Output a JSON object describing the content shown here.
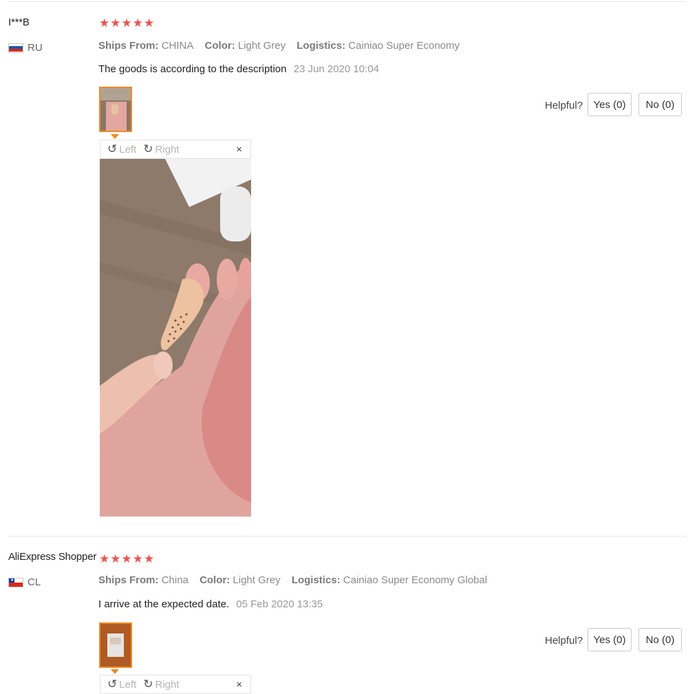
{
  "reviews": [
    {
      "user": "I***B",
      "country": "RU",
      "flag_icon": "russia-flag-icon",
      "stars": "★★★★★",
      "ships_from_label": "Ships From:",
      "ships_from": "CHINA",
      "color_label": "Color:",
      "color": "Light Grey",
      "logistics_label": "Logistics:",
      "logistics": "Cainiao Super Economy",
      "text": "The goods is according to the description",
      "date": "23 Jun 2020 10:04",
      "viewer": {
        "left": "Left",
        "right": "Right",
        "close": "×"
      },
      "helpful_label": "Helpful?",
      "yes_label": "Yes (0)",
      "no_label": "No (0)"
    },
    {
      "user": "AliExpress Shopper",
      "country": "CL",
      "flag_icon": "chile-flag-icon",
      "stars": "★★★★★",
      "ships_from_label": "Ships From:",
      "ships_from": "China",
      "color_label": "Color:",
      "color": "Light Grey",
      "logistics_label": "Logistics:",
      "logistics": "Cainiao Super Economy Global",
      "text": "I arrive at the expected date.",
      "date": "05 Feb 2020 13:35",
      "viewer": {
        "left": "Left",
        "right": "Right",
        "close": "×"
      },
      "helpful_label": "Helpful?",
      "yes_label": "Yes (0)",
      "no_label": "No (0)"
    }
  ],
  "colors": {
    "stars": "#f0524f",
    "thumb_border": "#f08a24"
  }
}
